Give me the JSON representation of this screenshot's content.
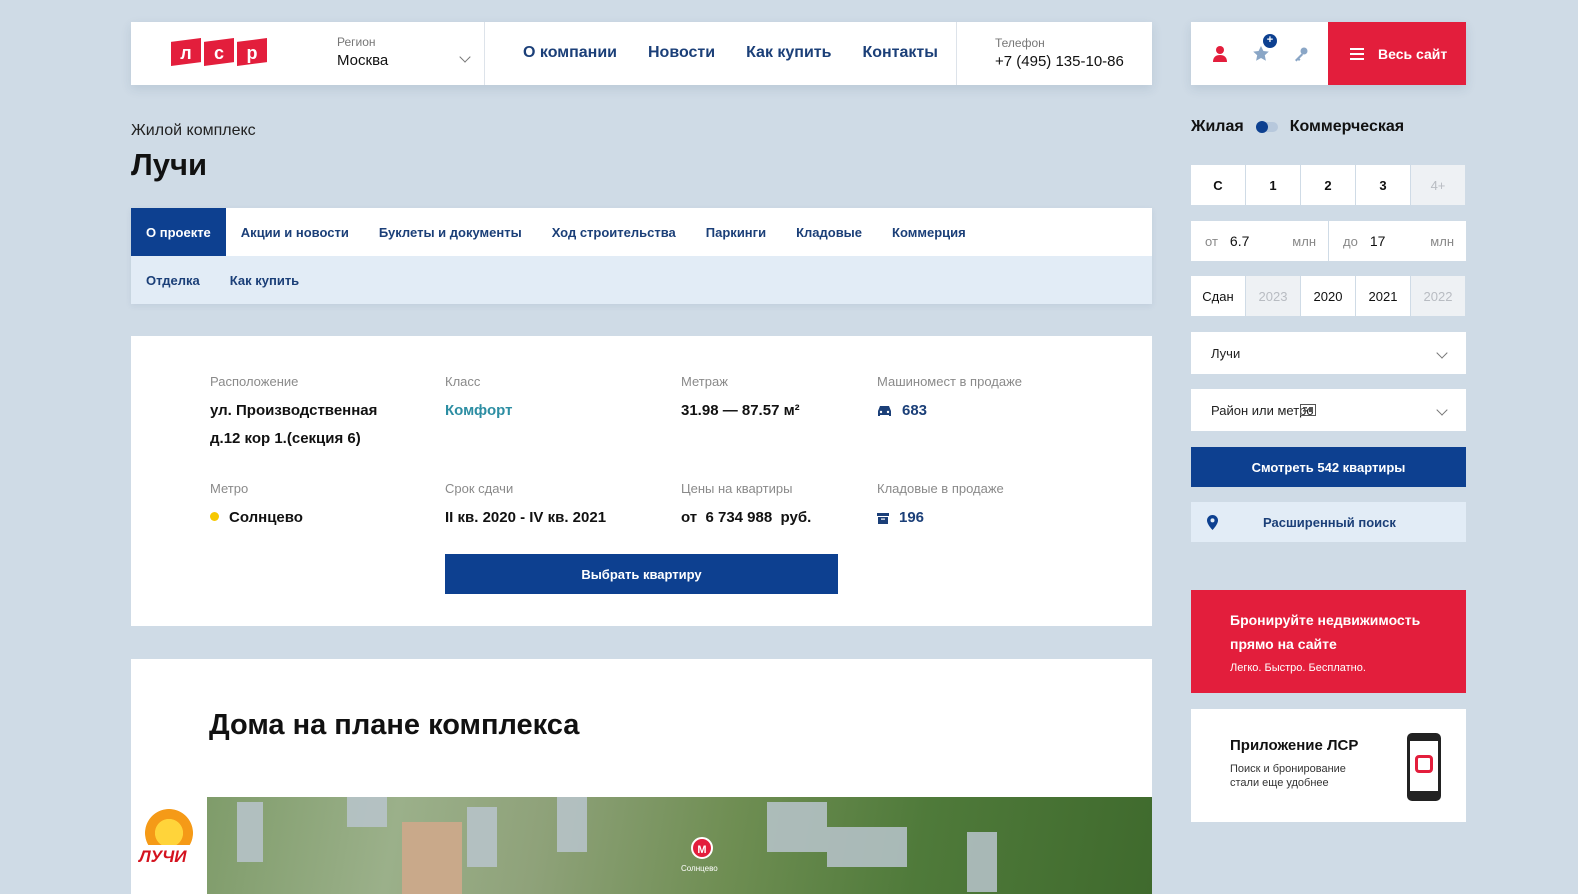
{
  "header": {
    "logo_letters": [
      "л",
      "с",
      "р"
    ],
    "region_label": "Регион",
    "region_value": "Москва",
    "nav": [
      "О компании",
      "Новости",
      "Как купить",
      "Контакты"
    ],
    "phone_label": "Телефон",
    "phone_value": "+7 (495) 135-10-86",
    "menu_label": "Весь сайт",
    "icons": [
      "user-icon",
      "star-icon",
      "key-icon",
      "menu-icon"
    ],
    "accent": "#e31e3c"
  },
  "page": {
    "pre_title": "Жилой комплекс",
    "title": "Лучи"
  },
  "tabs": {
    "row1": [
      "О проекте",
      "Акции и новости",
      "Буклеты и документы",
      "Ход строительства",
      "Паркинги",
      "Кладовые",
      "Коммерция"
    ],
    "row2": [
      "Отделка",
      "Как купить"
    ],
    "active": "О проекте"
  },
  "info": {
    "location_label": "Расположение",
    "location_line1": "ул. Производственная",
    "location_line2": "д.12 кор 1.(секция 6)",
    "class_label": "Класс",
    "class_value": "Комфорт",
    "area_label": "Метраж",
    "area_value": "31.98 — 87.57 м²",
    "parking_label": "Машиномест в продаже",
    "parking_value": "683",
    "metro_label": "Метро",
    "metro_value": "Солнцево",
    "deadline_label": "Срок сдачи",
    "deadline_value": "II кв. 2020 - IV кв. 2021",
    "price_label": "Цены на квартиры",
    "price_value": "от  6 734 988  руб.",
    "storage_label": "Кладовые в продаже",
    "storage_value": "196",
    "choose_button": "Выбрать квартиру"
  },
  "plan": {
    "title": "Дома на плане комплекса",
    "metro_letter": "М",
    "metro_caption": "Солнцево",
    "logo_text": "ЛУЧИ"
  },
  "filter": {
    "seg_left": "Жилая",
    "seg_right": "Коммерческая",
    "rooms": [
      "С",
      "1",
      "2",
      "3",
      "4+"
    ],
    "price_from_label": "от",
    "price_from": "6.7",
    "price_to_label": "до",
    "price_to": "17",
    "unit": "млн",
    "years": [
      "Сдан",
      "2023",
      "2020",
      "2021",
      "2022"
    ],
    "complex_select": "Лучи",
    "district_placeholder": "Район или метро",
    "show_button": "Смотреть 542 квартиры",
    "advanced_search": "Расширенный поиск"
  },
  "promo": {
    "title_line1": "Бронируйте недвижимость",
    "title_line2": "прямо на сайте",
    "subtitle": "Легко. Быстро. Бесплатно."
  },
  "app": {
    "title": "Приложение ЛСР",
    "subtitle_line1": "Поиск и бронирование",
    "subtitle_line2": "стали еще удобнее"
  }
}
